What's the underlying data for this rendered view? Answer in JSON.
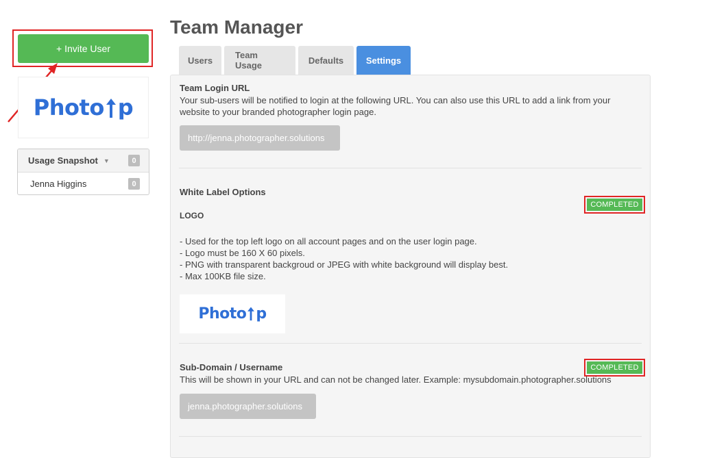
{
  "sidebar": {
    "invite_label": "+ Invite User",
    "logo_text_left": "Photo",
    "logo_text_right": "p",
    "snapshot": {
      "title": "Usage Snapshot",
      "count": "0",
      "rows": [
        {
          "name": "Jenna Higgins",
          "count": "0"
        }
      ]
    }
  },
  "header": {
    "title": "Team Manager"
  },
  "tabs": [
    {
      "label": "Users",
      "active": false
    },
    {
      "label": "Team Usage",
      "active": false
    },
    {
      "label": "Defaults",
      "active": false
    },
    {
      "label": "Settings",
      "active": true
    }
  ],
  "settings": {
    "login_url": {
      "title": "Team Login URL",
      "description": "Your sub-users will be notified to login at the following URL. You can also use this URL to add a link from your website to your branded photographer login page.",
      "url": "http://jenna.photographer.solutions"
    },
    "white_label": {
      "title": "White Label Options",
      "status": "COMPLETED",
      "logo_heading": "LOGO",
      "requirements": [
        "- Used for the top left logo on all account pages and on the user login page.",
        "- Logo must be 160 X 60 pixels.",
        "- PNG with transparent backgroud or JPEG with white background will display best.",
        "- Max 100KB file size."
      ]
    },
    "subdomain": {
      "title": "Sub-Domain / Username",
      "status": "COMPLETED",
      "description": "This will be shown in your URL and can not be changed later. Example: mysubdomain.photographer.solutions",
      "value": "jenna.photographer.solutions"
    }
  },
  "colors": {
    "accent_green": "#55b955",
    "tab_active_blue": "#4a8fe0",
    "highlight_red": "#e02424",
    "logo_blue": "#2f6fd6"
  },
  "icons": {
    "annotation": "red-arrow-icon",
    "caret": "caret-down-icon",
    "logo_arrow": "up-arrow-icon"
  }
}
